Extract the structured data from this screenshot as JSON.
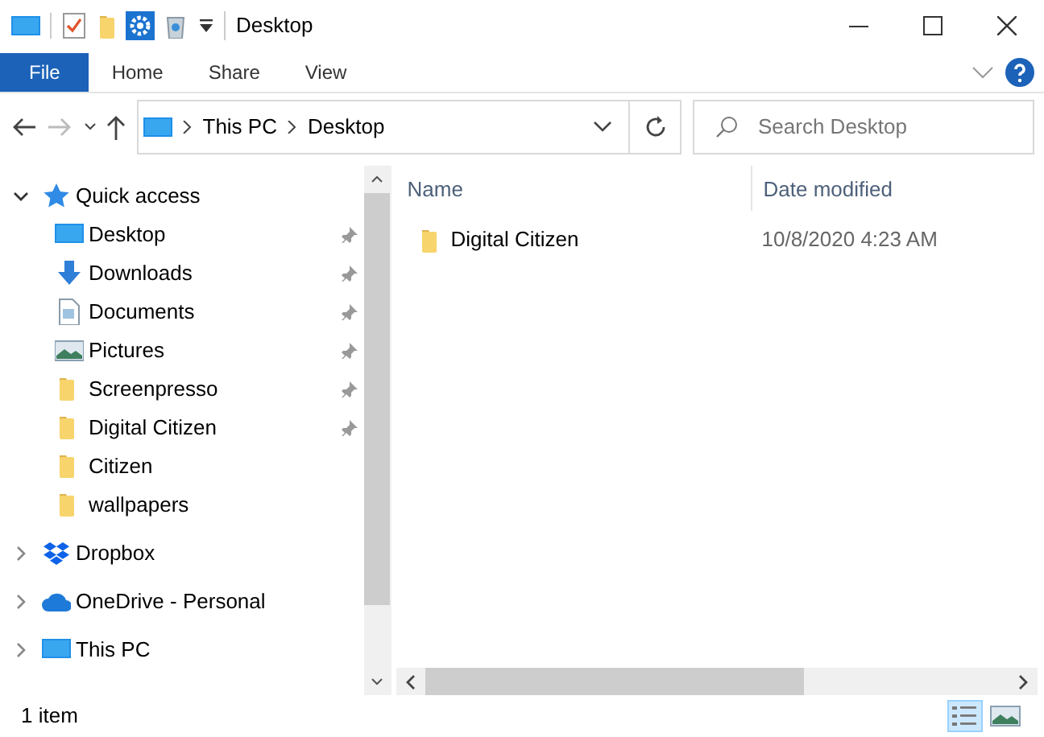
{
  "window": {
    "title": "Desktop"
  },
  "ribbon_tabs": [
    {
      "label": "File",
      "kind": "file"
    },
    {
      "label": "Home",
      "kind": "tab"
    },
    {
      "label": "Share",
      "kind": "tab"
    },
    {
      "label": "View",
      "kind": "tab"
    }
  ],
  "address_bar": {
    "breadcrumbs": [
      "This PC",
      "Desktop"
    ]
  },
  "search": {
    "placeholder": "Search Desktop"
  },
  "navigation_pane": [
    {
      "label": "Quick access",
      "kind": "star",
      "expanded": true,
      "children": [
        {
          "label": "Desktop",
          "kind": "desktop",
          "pinned": true
        },
        {
          "label": "Downloads",
          "kind": "download",
          "pinned": true
        },
        {
          "label": "Documents",
          "kind": "document",
          "pinned": true
        },
        {
          "label": "Pictures",
          "kind": "picture",
          "pinned": true
        },
        {
          "label": "Screenpresso",
          "kind": "folder",
          "pinned": true
        },
        {
          "label": "Digital Citizen",
          "kind": "folder",
          "pinned": true
        },
        {
          "label": "Citizen",
          "kind": "folder",
          "pinned": false
        },
        {
          "label": "wallpapers",
          "kind": "folder",
          "pinned": false
        }
      ]
    },
    {
      "label": "Dropbox",
      "kind": "dropbox",
      "expanded": false
    },
    {
      "label": "OneDrive - Personal",
      "kind": "cloud",
      "expanded": false
    },
    {
      "label": "This PC",
      "kind": "desktop",
      "expanded": false
    }
  ],
  "file_list": {
    "columns": [
      "Name",
      "Date modified"
    ],
    "rows": [
      {
        "name": "Digital Citizen",
        "date_modified": "10/8/2020 4:23 AM"
      }
    ]
  },
  "status_bar": {
    "text": "1 item",
    "views": [
      {
        "kind": "details",
        "selected": true
      },
      {
        "kind": "large-icons",
        "selected": false
      }
    ]
  }
}
